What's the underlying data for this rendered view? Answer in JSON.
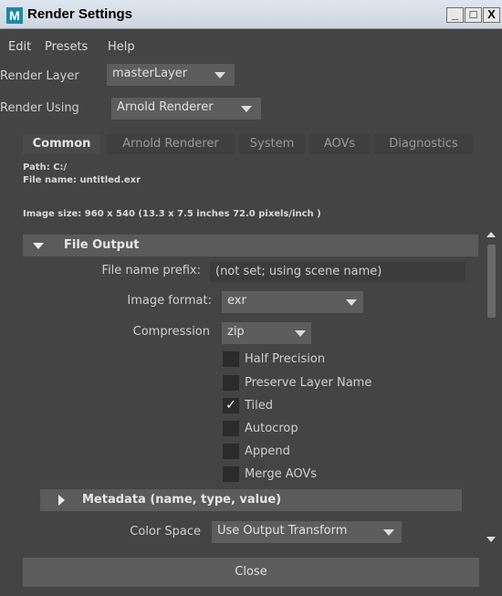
{
  "window": {
    "title": "Render Settings",
    "icon": "M"
  },
  "menu": {
    "edit": "Edit",
    "presets": "Presets",
    "help": "Help"
  },
  "render_layer": {
    "label": "Render Layer",
    "value": "masterLayer"
  },
  "render_using": {
    "label": "Render Using",
    "value": "Arnold Renderer"
  },
  "tabs": [
    {
      "label": "Common",
      "active": true
    },
    {
      "label": "Arnold Renderer"
    },
    {
      "label": "System"
    },
    {
      "label": "AOVs"
    },
    {
      "label": "Diagnostics"
    }
  ],
  "info": {
    "path": "Path: C:/",
    "file_name": "File name:  untitled.exr",
    "image_size": "Image size: 960 x 540 (13.3 x 7.5 inches 72.0 pixels/inch )"
  },
  "file_output": {
    "header": "File Output",
    "file_name_prefix": {
      "label": "File name prefix:",
      "value": "(not set; using scene name)"
    },
    "image_format": {
      "label": "Image format:",
      "value": "exr"
    },
    "compression": {
      "label": "Compression",
      "value": "zip"
    },
    "checkboxes": [
      {
        "label": "Half Precision",
        "checked": false
      },
      {
        "label": "Preserve Layer Name",
        "checked": false
      },
      {
        "label": "Tiled",
        "checked": true
      },
      {
        "label": "Autocrop",
        "checked": false
      },
      {
        "label": "Append",
        "checked": false
      },
      {
        "label": "Merge AOVs",
        "checked": false
      }
    ],
    "checkmark_glyph": "✓"
  },
  "metadata": {
    "header": "Metadata (name, type, value)"
  },
  "color_space": {
    "label": "Color Space",
    "value": "Use Output Transform"
  },
  "close_button": "Close",
  "window_buttons": {
    "minimize": "_",
    "maximize": "□",
    "close": "X"
  }
}
